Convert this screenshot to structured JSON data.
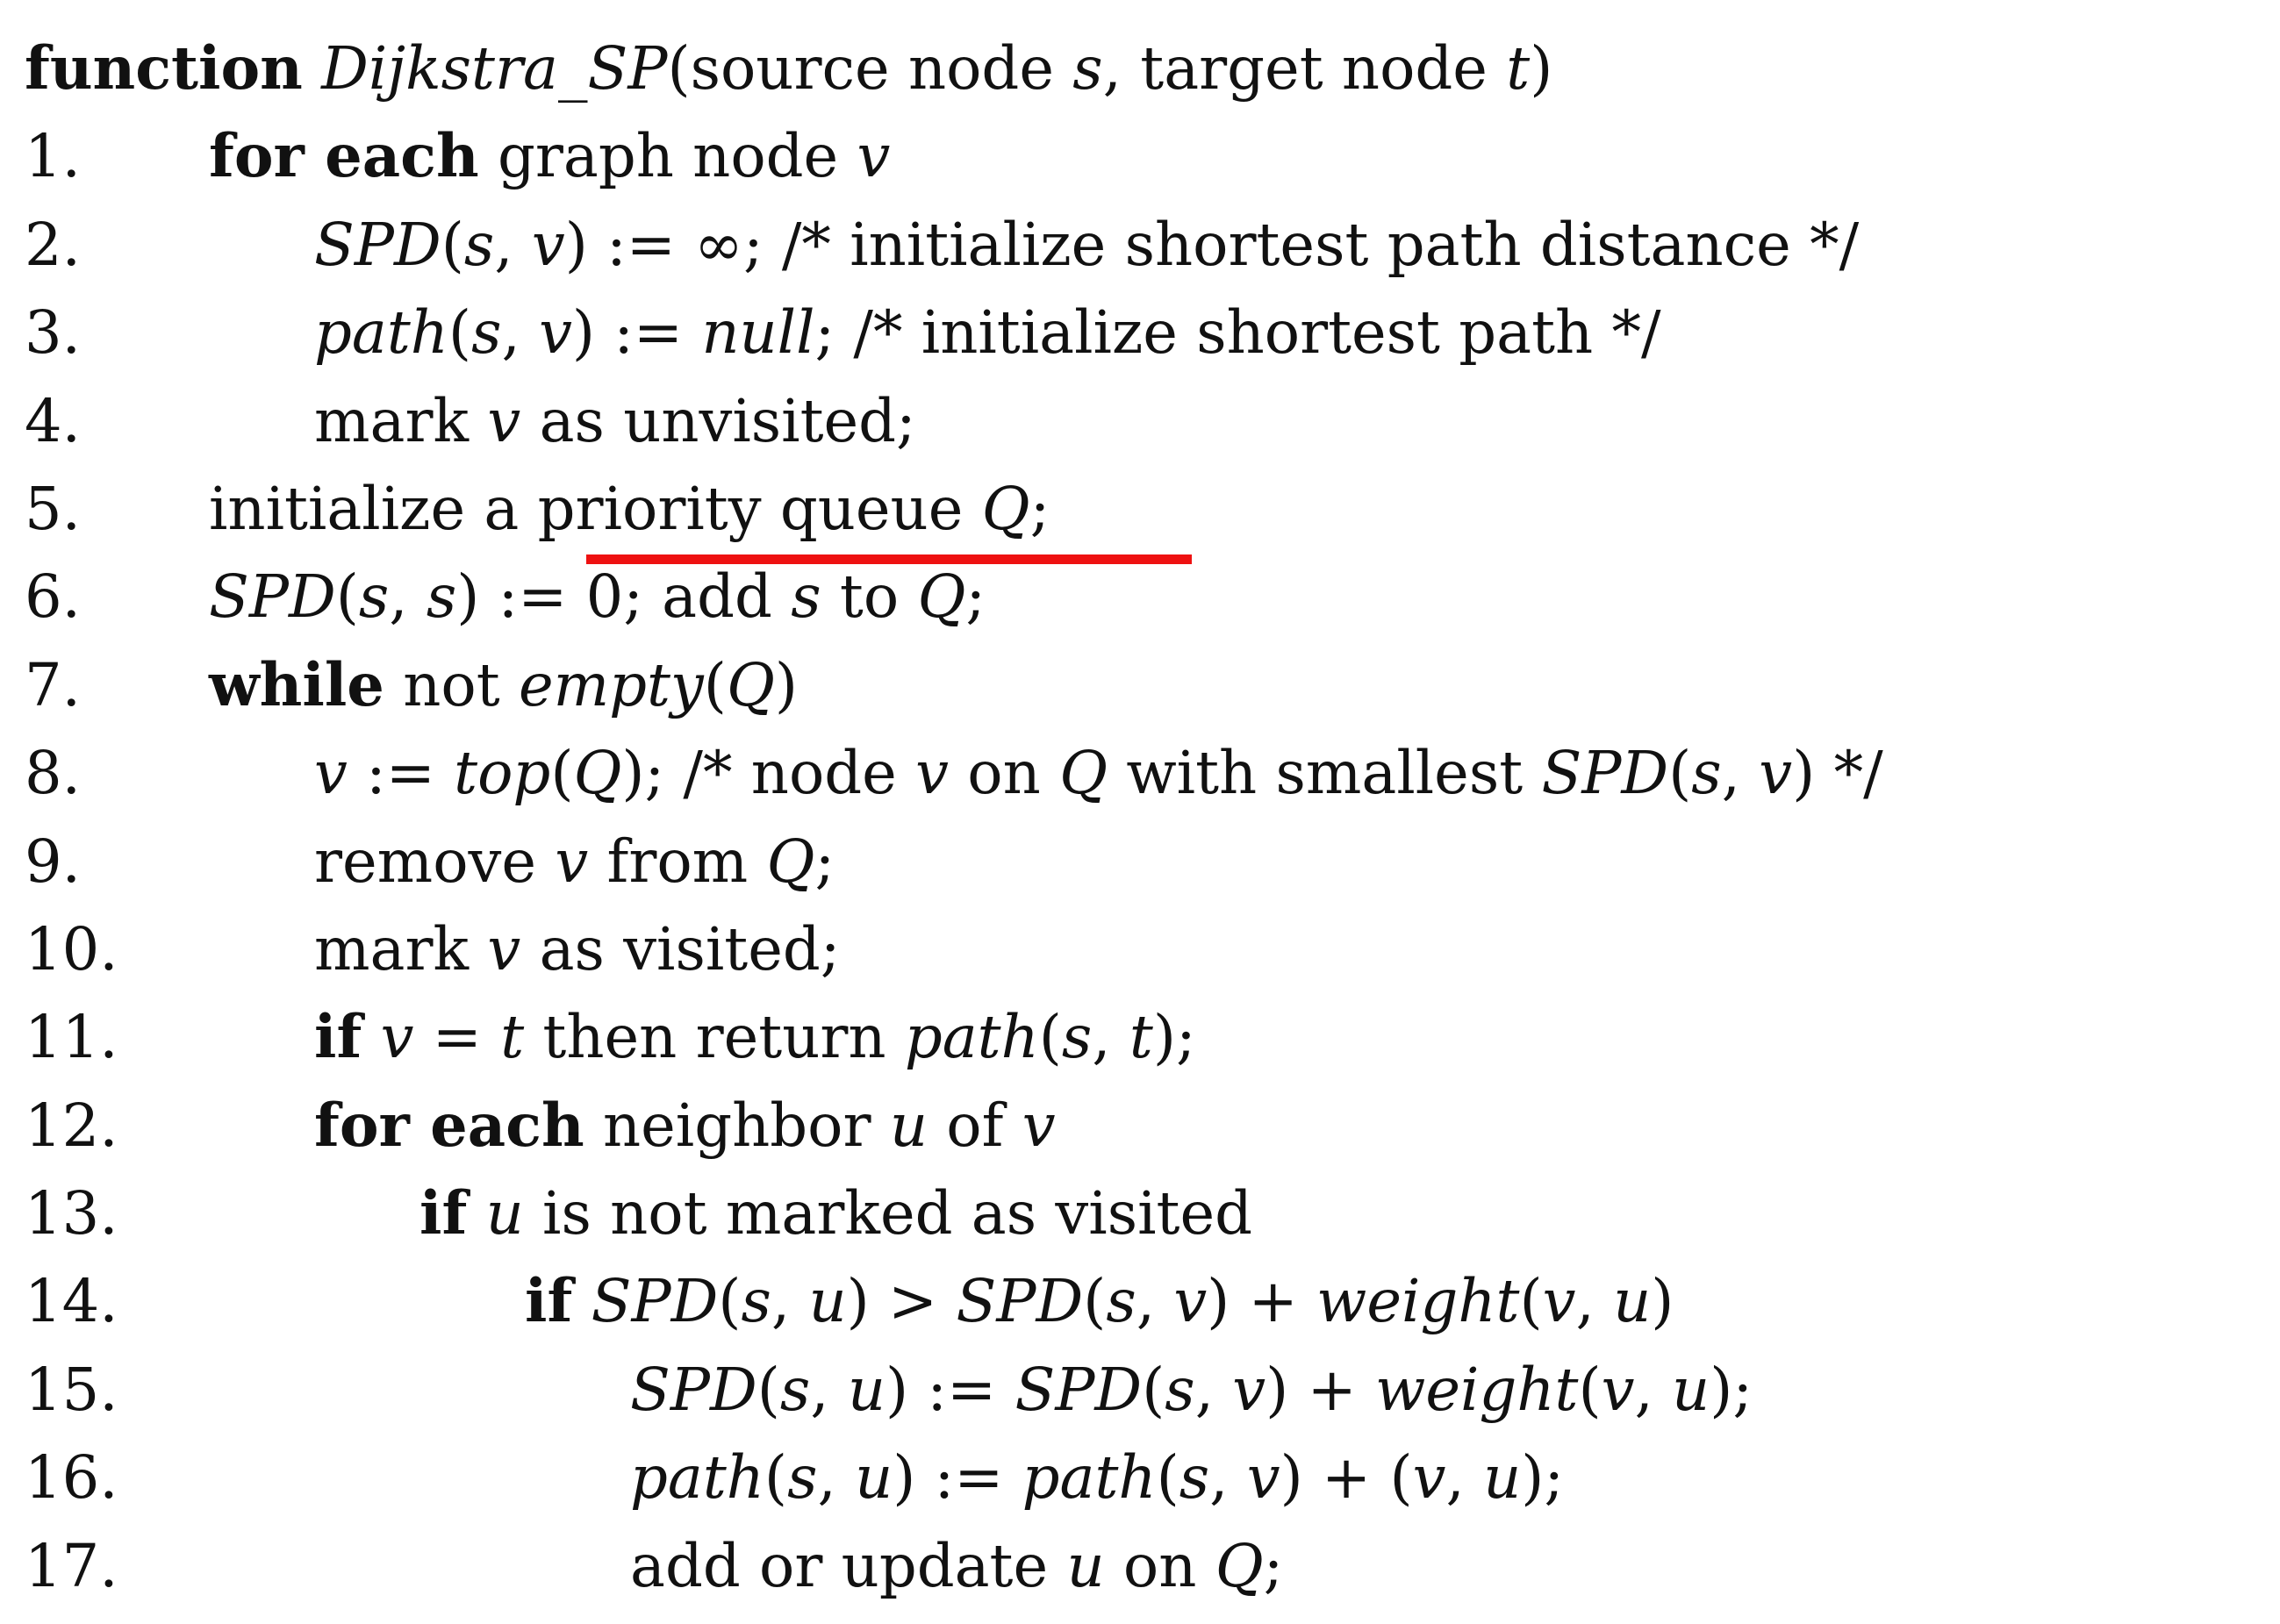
{
  "header": {
    "keyword": "function",
    "name": "Dijkstra_SP",
    "params_open": "(source node ",
    "param_s": "s",
    "params_mid": ", target node ",
    "param_t": "t",
    "params_close": ")"
  },
  "lines": [
    {
      "num": "1.",
      "indent": 1,
      "parts": [
        {
          "t": "kw",
          "v": "for each"
        },
        {
          "t": "txt",
          "v": " graph node "
        },
        {
          "t": "m",
          "v": "v"
        }
      ]
    },
    {
      "num": "2.",
      "indent": 2,
      "parts": [
        {
          "t": "m",
          "v": "SPD"
        },
        {
          "t": "txt",
          "v": "("
        },
        {
          "t": "m",
          "v": "s"
        },
        {
          "t": "txt",
          "v": ", "
        },
        {
          "t": "m",
          "v": "v"
        },
        {
          "t": "txt",
          "v": ") := ∞; /* initialize shortest path distance */"
        }
      ]
    },
    {
      "num": "3.",
      "indent": 2,
      "parts": [
        {
          "t": "m",
          "v": "path"
        },
        {
          "t": "txt",
          "v": "("
        },
        {
          "t": "m",
          "v": "s"
        },
        {
          "t": "txt",
          "v": ", "
        },
        {
          "t": "m",
          "v": "v"
        },
        {
          "t": "txt",
          "v": ") := "
        },
        {
          "t": "m",
          "v": "null"
        },
        {
          "t": "txt",
          "v": "; /* initialize shortest path */"
        }
      ]
    },
    {
      "num": "4.",
      "indent": 2,
      "parts": [
        {
          "t": "txt",
          "v": "mark "
        },
        {
          "t": "m",
          "v": "v"
        },
        {
          "t": "txt",
          "v": " as unvisited;"
        }
      ]
    },
    {
      "num": "5.",
      "indent": 1,
      "parts": [
        {
          "t": "txt",
          "v": "initialize a "
        },
        {
          "t": "txt",
          "v": "priority queue "
        },
        {
          "t": "m",
          "v": "Q"
        },
        {
          "t": "txt",
          "v": ";"
        }
      ]
    },
    {
      "num": "6.",
      "indent": 1,
      "parts": [
        {
          "t": "m",
          "v": "SPD"
        },
        {
          "t": "txt",
          "v": "("
        },
        {
          "t": "m",
          "v": "s"
        },
        {
          "t": "txt",
          "v": ", "
        },
        {
          "t": "m",
          "v": "s"
        },
        {
          "t": "txt",
          "v": ") := 0; add "
        },
        {
          "t": "m",
          "v": "s"
        },
        {
          "t": "txt",
          "v": " to "
        },
        {
          "t": "m",
          "v": "Q"
        },
        {
          "t": "txt",
          "v": ";"
        }
      ]
    },
    {
      "num": "7.",
      "indent": 1,
      "parts": [
        {
          "t": "kw",
          "v": "while"
        },
        {
          "t": "txt",
          "v": " not "
        },
        {
          "t": "m",
          "v": "empty"
        },
        {
          "t": "txt",
          "v": "("
        },
        {
          "t": "m",
          "v": "Q"
        },
        {
          "t": "txt",
          "v": ")"
        }
      ]
    },
    {
      "num": "8.",
      "indent": 2,
      "parts": [
        {
          "t": "m",
          "v": "v"
        },
        {
          "t": "txt",
          "v": " := "
        },
        {
          "t": "m",
          "v": "top"
        },
        {
          "t": "txt",
          "v": "("
        },
        {
          "t": "m",
          "v": "Q"
        },
        {
          "t": "txt",
          "v": "); /* node "
        },
        {
          "t": "m",
          "v": "v"
        },
        {
          "t": "txt",
          "v": " on "
        },
        {
          "t": "m",
          "v": "Q"
        },
        {
          "t": "txt",
          "v": " with smallest "
        },
        {
          "t": "m",
          "v": "SPD"
        },
        {
          "t": "txt",
          "v": "("
        },
        {
          "t": "m",
          "v": "s"
        },
        {
          "t": "txt",
          "v": ", "
        },
        {
          "t": "m",
          "v": "v"
        },
        {
          "t": "txt",
          "v": ") */"
        }
      ]
    },
    {
      "num": "9.",
      "indent": 2,
      "parts": [
        {
          "t": "txt",
          "v": "remove "
        },
        {
          "t": "m",
          "v": "v"
        },
        {
          "t": "txt",
          "v": " from "
        },
        {
          "t": "m",
          "v": "Q"
        },
        {
          "t": "txt",
          "v": ";"
        }
      ]
    },
    {
      "num": "10.",
      "indent": 2,
      "parts": [
        {
          "t": "txt",
          "v": "mark "
        },
        {
          "t": "m",
          "v": "v"
        },
        {
          "t": "txt",
          "v": " as visited;"
        }
      ]
    },
    {
      "num": "11.",
      "indent": 2,
      "parts": [
        {
          "t": "kw",
          "v": "if"
        },
        {
          "t": "txt",
          "v": " "
        },
        {
          "t": "m",
          "v": "v"
        },
        {
          "t": "txt",
          "v": " = "
        },
        {
          "t": "m",
          "v": "t"
        },
        {
          "t": "txt",
          "v": " then return "
        },
        {
          "t": "m",
          "v": "path"
        },
        {
          "t": "txt",
          "v": "("
        },
        {
          "t": "m",
          "v": "s"
        },
        {
          "t": "txt",
          "v": ", "
        },
        {
          "t": "m",
          "v": "t"
        },
        {
          "t": "txt",
          "v": ");"
        }
      ]
    },
    {
      "num": "12.",
      "indent": 2,
      "parts": [
        {
          "t": "kw",
          "v": "for each"
        },
        {
          "t": "txt",
          "v": " neighbor "
        },
        {
          "t": "m",
          "v": "u"
        },
        {
          "t": "txt",
          "v": " of "
        },
        {
          "t": "m",
          "v": "v"
        }
      ]
    },
    {
      "num": "13.",
      "indent": 3,
      "parts": [
        {
          "t": "kw",
          "v": "if"
        },
        {
          "t": "txt",
          "v": " "
        },
        {
          "t": "m",
          "v": "u"
        },
        {
          "t": "txt",
          "v": " is not marked as visited"
        }
      ]
    },
    {
      "num": "14.",
      "indent": 4,
      "parts": [
        {
          "t": "kw",
          "v": "if"
        },
        {
          "t": "txt",
          "v": " "
        },
        {
          "t": "m",
          "v": "SPD"
        },
        {
          "t": "txt",
          "v": "("
        },
        {
          "t": "m",
          "v": "s"
        },
        {
          "t": "txt",
          "v": ", "
        },
        {
          "t": "m",
          "v": "u"
        },
        {
          "t": "txt",
          "v": ") > "
        },
        {
          "t": "m",
          "v": "SPD"
        },
        {
          "t": "txt",
          "v": "("
        },
        {
          "t": "m",
          "v": "s"
        },
        {
          "t": "txt",
          "v": ", "
        },
        {
          "t": "m",
          "v": "v"
        },
        {
          "t": "txt",
          "v": ") + "
        },
        {
          "t": "m",
          "v": "weight"
        },
        {
          "t": "txt",
          "v": "("
        },
        {
          "t": "m",
          "v": "v"
        },
        {
          "t": "txt",
          "v": ", "
        },
        {
          "t": "m",
          "v": "u"
        },
        {
          "t": "txt",
          "v": ")"
        }
      ]
    },
    {
      "num": "15.",
      "indent": 5,
      "parts": [
        {
          "t": "m",
          "v": "SPD"
        },
        {
          "t": "txt",
          "v": "("
        },
        {
          "t": "m",
          "v": "s"
        },
        {
          "t": "txt",
          "v": ", "
        },
        {
          "t": "m",
          "v": "u"
        },
        {
          "t": "txt",
          "v": ") := "
        },
        {
          "t": "m",
          "v": "SPD"
        },
        {
          "t": "txt",
          "v": "("
        },
        {
          "t": "m",
          "v": "s"
        },
        {
          "t": "txt",
          "v": ", "
        },
        {
          "t": "m",
          "v": "v"
        },
        {
          "t": "txt",
          "v": ") + "
        },
        {
          "t": "m",
          "v": "weight"
        },
        {
          "t": "txt",
          "v": "("
        },
        {
          "t": "m",
          "v": "v"
        },
        {
          "t": "txt",
          "v": ", "
        },
        {
          "t": "m",
          "v": "u"
        },
        {
          "t": "txt",
          "v": ");"
        }
      ]
    },
    {
      "num": "16.",
      "indent": 5,
      "parts": [
        {
          "t": "m",
          "v": "path"
        },
        {
          "t": "txt",
          "v": "("
        },
        {
          "t": "m",
          "v": "s"
        },
        {
          "t": "txt",
          "v": ", "
        },
        {
          "t": "m",
          "v": "u"
        },
        {
          "t": "txt",
          "v": ") := "
        },
        {
          "t": "m",
          "v": "path"
        },
        {
          "t": "txt",
          "v": "("
        },
        {
          "t": "m",
          "v": "s"
        },
        {
          "t": "txt",
          "v": ", "
        },
        {
          "t": "m",
          "v": "v"
        },
        {
          "t": "txt",
          "v": ") + ("
        },
        {
          "t": "m",
          "v": "v"
        },
        {
          "t": "txt",
          "v": ", "
        },
        {
          "t": "m",
          "v": "u"
        },
        {
          "t": "txt",
          "v": ");"
        }
      ]
    },
    {
      "num": "17.",
      "indent": 5,
      "parts": [
        {
          "t": "txt",
          "v": "add or update "
        },
        {
          "t": "m",
          "v": "u"
        },
        {
          "t": "txt",
          "v": " on "
        },
        {
          "t": "m",
          "v": "Q"
        },
        {
          "t": "txt",
          "v": ";"
        }
      ]
    }
  ],
  "highlight": {
    "line": "5.",
    "phrase": "priority queue Q;",
    "color": "#ee1111"
  }
}
